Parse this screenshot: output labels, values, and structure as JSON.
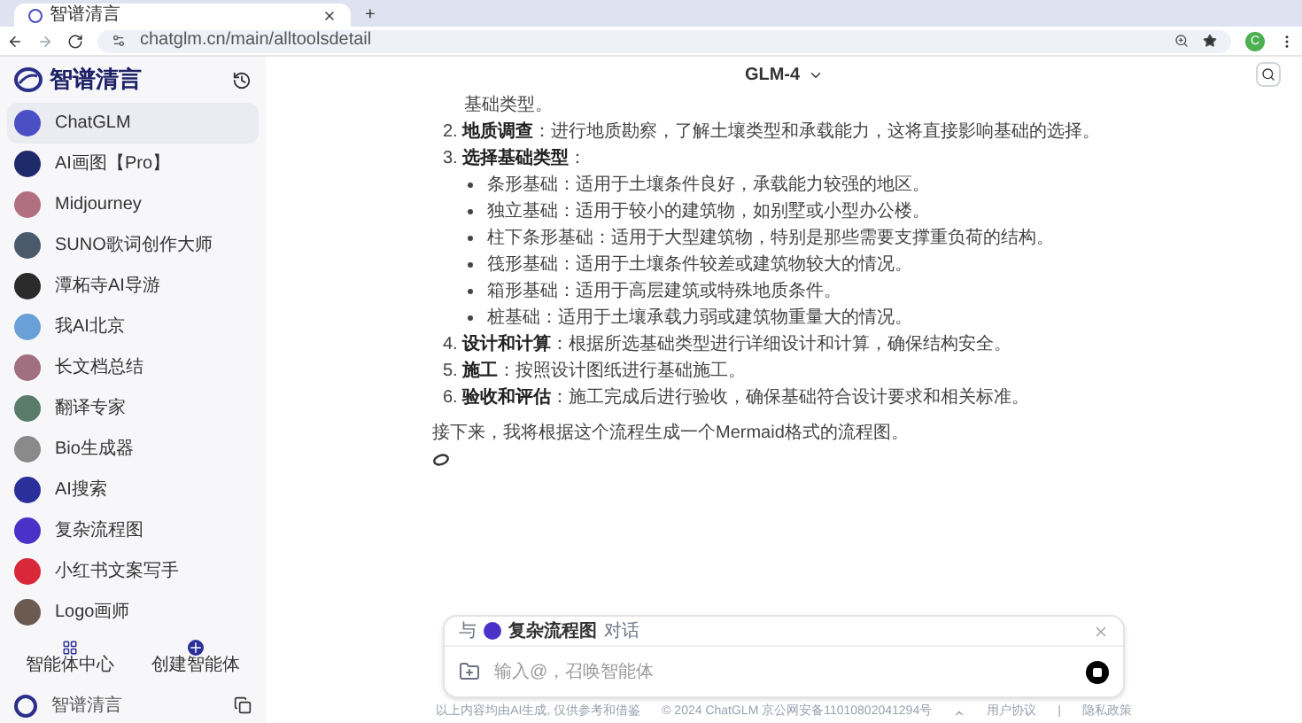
{
  "browser": {
    "tab_title": "智谱清言",
    "new_tab": "+",
    "url": "chatglm.cn/main/alltoolsdetail",
    "profile": "C"
  },
  "sidebar": {
    "brand": "智谱清言",
    "items": [
      {
        "label": "ChatGLM",
        "selected": true,
        "color": "#4b4fc4"
      },
      {
        "label": "AI画图【Pro】",
        "selected": false,
        "color": "#1f2a6b"
      },
      {
        "label": "Midjourney",
        "selected": false,
        "color": "#b07080"
      },
      {
        "label": "SUNO歌词创作大师",
        "selected": false,
        "color": "#4a5a6a"
      },
      {
        "label": "潭柘寺AI导游",
        "selected": false,
        "color": "#2a2a2a"
      },
      {
        "label": "我AI北京",
        "selected": false,
        "color": "#6aa0d8"
      },
      {
        "label": "长文档总结",
        "selected": false,
        "color": "#a07080"
      },
      {
        "label": "翻译专家",
        "selected": false,
        "color": "#5a7a6a"
      },
      {
        "label": "Bio生成器",
        "selected": false,
        "color": "#8a8a8a"
      },
      {
        "label": "AI搜索",
        "selected": false,
        "color": "#2a2f9a"
      },
      {
        "label": "复杂流程图",
        "selected": false,
        "color": "#4a32c8"
      },
      {
        "label": "小红书文案写手",
        "selected": false,
        "color": "#d8283a"
      },
      {
        "label": "Logo画师",
        "selected": false,
        "color": "#6a5a50"
      }
    ],
    "actions": [
      "智能体中心",
      "创建智能体"
    ],
    "footer_brand": "智谱清言"
  },
  "header": {
    "model": "GLM-4"
  },
  "message": {
    "lead": "基础类型。",
    "steps": [
      {
        "number": "2.",
        "title": "地质调查",
        "text": "：进行地质勘察，了解土壤类型和承载能力，这将直接影响基础的选择。"
      },
      {
        "number": "3.",
        "title": "选择基础类型",
        "text": "：",
        "children": [
          {
            "text": "条形基础：适用于土壤条件良好，承载能力较强的地区。"
          },
          {
            "text": "独立基础：适用于较小的建筑物，如别墅或小型办公楼。"
          },
          {
            "text": "柱下条形基础：适用于大型建筑物，特别是那些需要支撑重负荷的结构。"
          },
          {
            "text": "筏形基础：适用于土壤条件较差或建筑物较大的情况。"
          },
          {
            "text": "箱形基础：适用于高层建筑或特殊地质条件。"
          },
          {
            "text": "桩基础：适用于土壤承载力弱或建筑物重量大的情况。"
          }
        ]
      },
      {
        "number": "4.",
        "title": "设计和计算",
        "text": "：根据所选基础类型进行详细设计和计算，确保结构安全。"
      },
      {
        "number": "5.",
        "title": "施工",
        "text": "：按照设计图纸进行基础施工。"
      },
      {
        "number": "6.",
        "title": "验收和评估",
        "text": "：施工完成后进行验收，确保基础符合设计要求和相关标准。"
      }
    ],
    "closing": "接下来，我将根据这个流程生成一个Mermaid格式的流程图。"
  },
  "composer": {
    "prefix": "与",
    "agent": "复杂流程图",
    "suffix": "对话",
    "placeholder": "输入@，召唤智能体"
  },
  "footer": {
    "disclaimer": "以上内容均由AI生成, 仅供参考和借鉴",
    "copyright": "© 2024 ChatGLM 京公网安备11010802041294号",
    "links": [
      "用户协议",
      "隐私政策"
    ],
    "separator": "|"
  }
}
